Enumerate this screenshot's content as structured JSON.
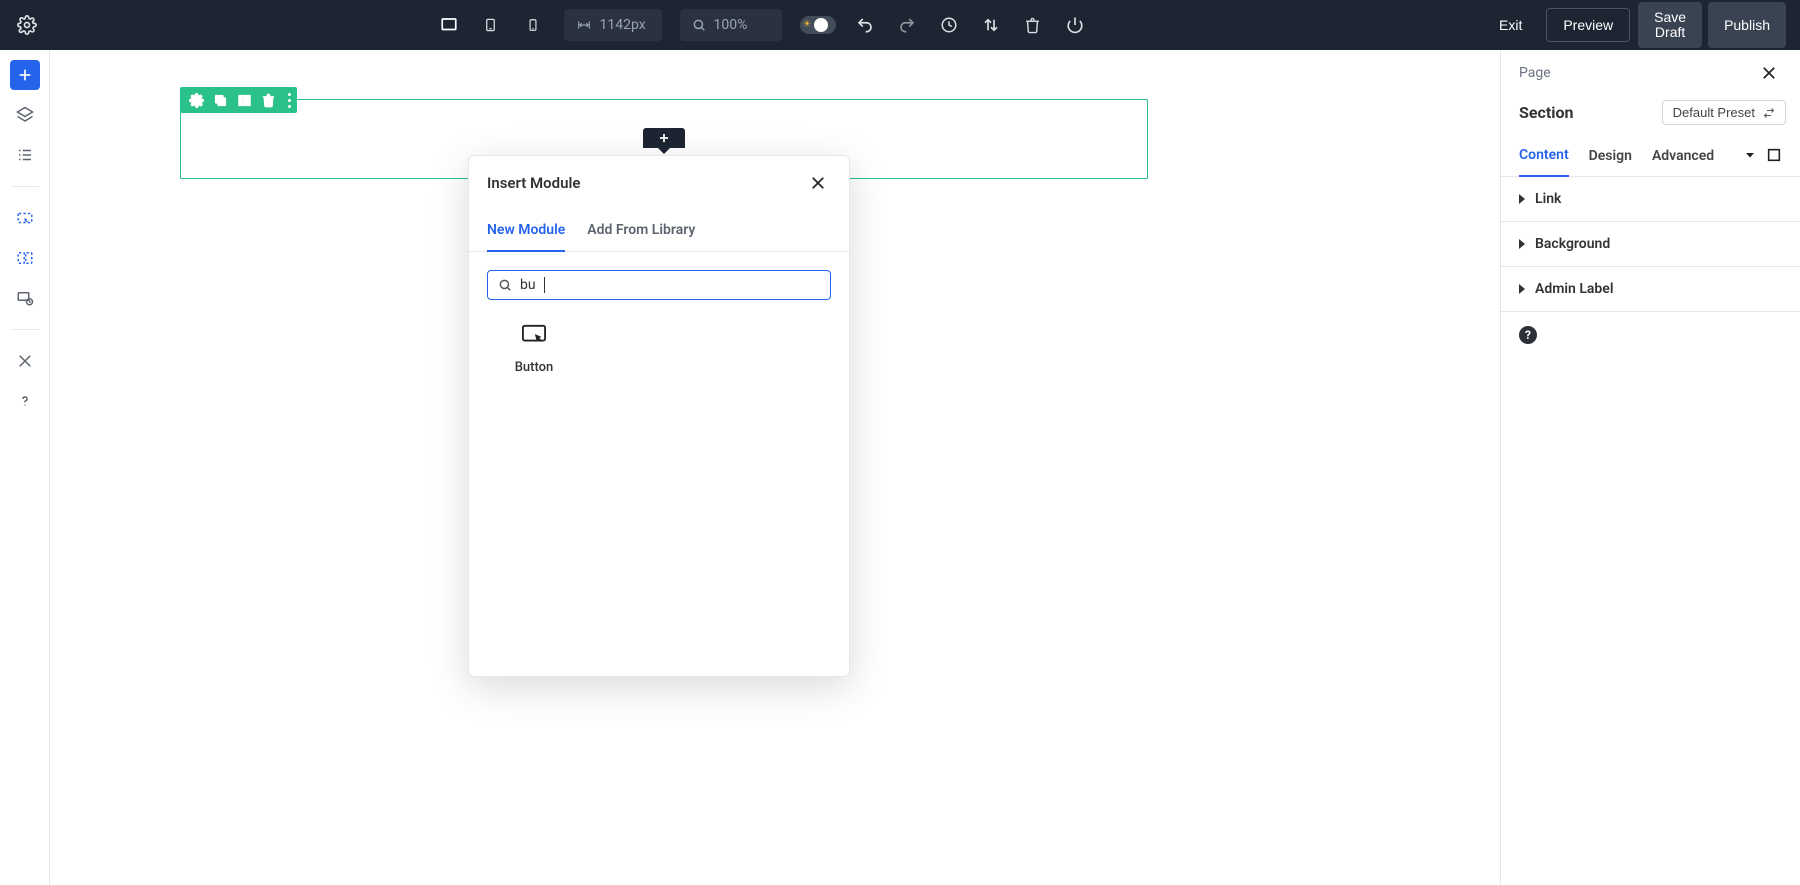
{
  "topbar": {
    "width_value": "1142px",
    "zoom_value": "100%",
    "buttons": {
      "exit": "Exit",
      "preview": "Preview",
      "save_draft": "Save\nDraft",
      "publish": "Publish"
    }
  },
  "modal": {
    "title": "Insert Module",
    "tabs": {
      "new": "New Module",
      "library": "Add From Library"
    },
    "search_value": "bu",
    "results": [
      {
        "label": "Button",
        "icon": "button-click-icon"
      }
    ]
  },
  "panel": {
    "breadcrumb": "Page",
    "section_title": "Section",
    "preset_label": "Default Preset",
    "tabs": {
      "content": "Content",
      "design": "Design",
      "advanced": "Advanced"
    },
    "groups": {
      "link": "Link",
      "background": "Background",
      "admin_label": "Admin Label"
    }
  }
}
